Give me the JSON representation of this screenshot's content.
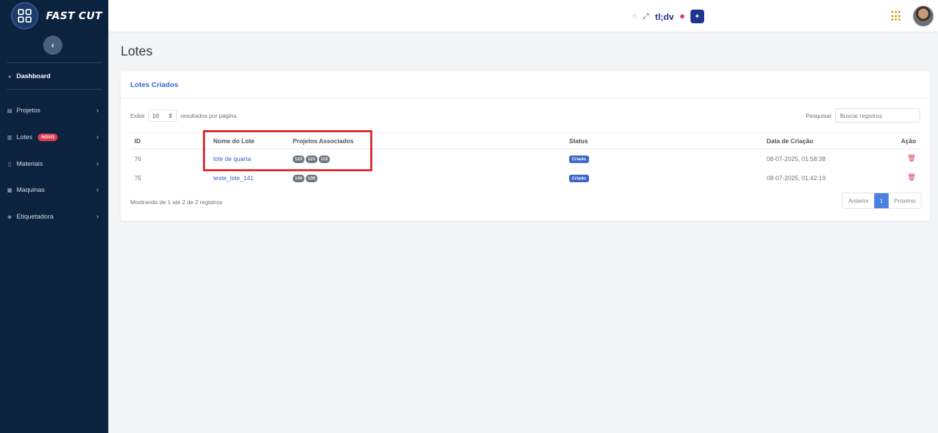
{
  "brand": {
    "name": "FAST CUT"
  },
  "sidebar": {
    "collapse_icon": "‹",
    "items": [
      {
        "label": "Dashboard",
        "icon": "dashboard-icon"
      },
      {
        "label": "Projetos",
        "icon": "projects-icon"
      },
      {
        "label": "Lotes",
        "icon": "lotes-icon",
        "badge": "NOVO"
      },
      {
        "label": "Materiais",
        "icon": "materials-icon"
      },
      {
        "label": "Maquinas",
        "icon": "machines-icon"
      },
      {
        "label": "Etiquetadora",
        "icon": "label-printer-icon"
      }
    ]
  },
  "topbar": {
    "ext_label": "tl;dv"
  },
  "page": {
    "title": "Lotes"
  },
  "card": {
    "title": "Lotes Criados",
    "length_prefix": "Exibir",
    "length_value": "10",
    "length_suffix": "resultados por página",
    "search_label": "Pesquisar",
    "search_placeholder": "Buscar registros"
  },
  "table": {
    "headers": [
      "ID",
      "Nome do Lote",
      "Projetos Associados",
      "Status",
      "Data de Criação",
      "Ação"
    ],
    "rows": [
      {
        "id": "76",
        "nome": "lote de quarta",
        "projetos": [
          "123",
          "121",
          "115"
        ],
        "status": "Criado",
        "data": "08-07-2025, 01:58:38"
      },
      {
        "id": "75",
        "nome": "teste_lote_141",
        "projetos": [
          "140",
          "139"
        ],
        "status": "Criado",
        "data": "08-07-2025, 01:42:19"
      }
    ]
  },
  "footer": {
    "info": "Mostrando de 1 até 2 de 2 registros",
    "prev": "Anterior",
    "page": "1",
    "next": "Próximo"
  },
  "colors": {
    "sidebar": "#0c2340",
    "accent": "#3b67c9",
    "danger": "#e23a4f",
    "highlight": "#e0282d"
  }
}
